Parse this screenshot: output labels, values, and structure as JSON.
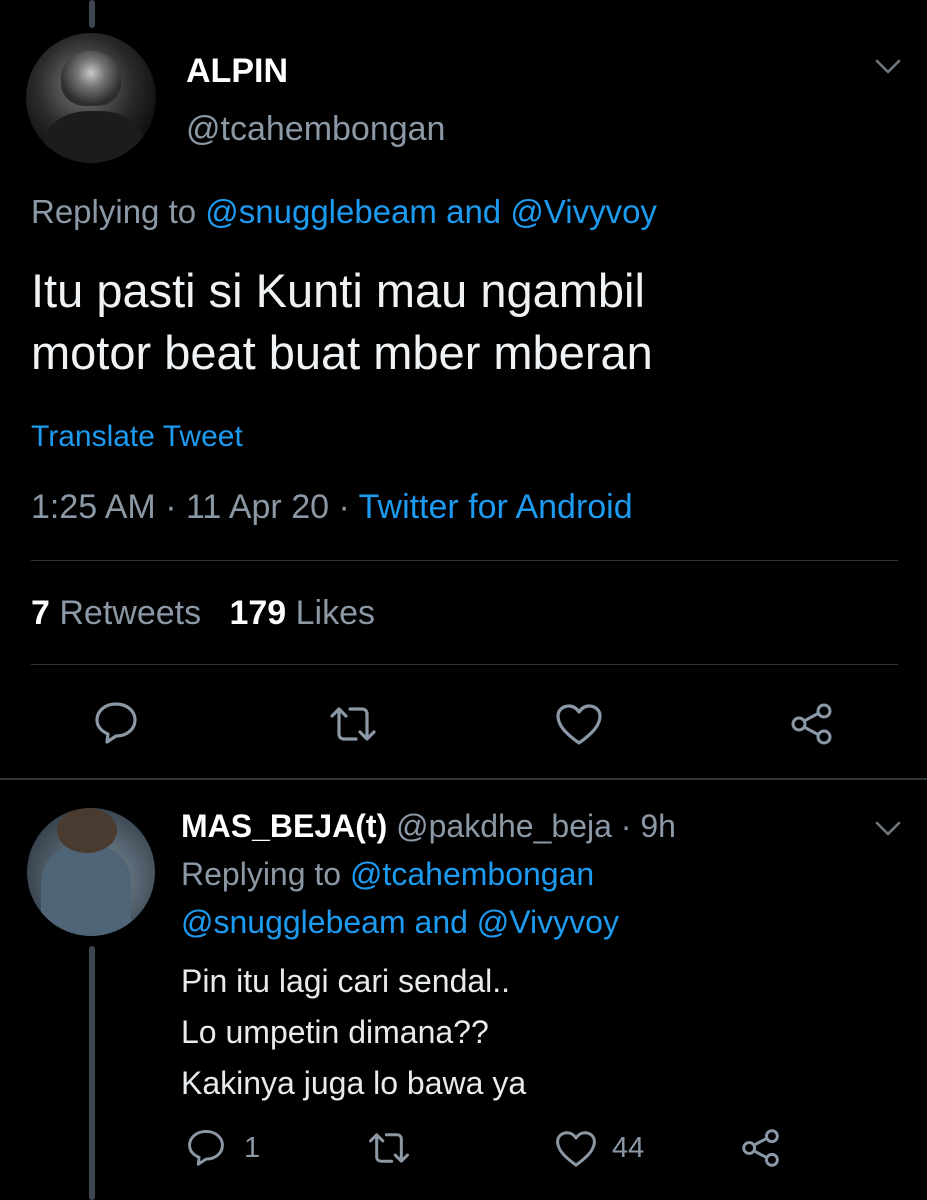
{
  "main_tweet": {
    "display_name": "ALPIN",
    "handle": "@tcahembongan",
    "replying_prefix": "Replying to ",
    "replying_user1": "@snugglebeam",
    "replying_and": " and ",
    "replying_user2": "@Vivyvoy",
    "text_line1": "Itu pasti si Kunti mau ngambil",
    "text_line2": "motor beat buat mber mberan",
    "translate_label": "Translate Tweet",
    "time": "1:25 AM",
    "sep1": " · ",
    "date": "11 Apr 20",
    "sep2": " · ",
    "source": "Twitter for Android",
    "retweets_count": "7",
    "retweets_label": "Retweets",
    "likes_count": "179",
    "likes_label": "Likes"
  },
  "reply_tweet": {
    "display_name": "MAS_BEJA(t)",
    "handle_time": "@pakdhe_beja · 9h",
    "replying_prefix": "Replying to ",
    "replying_user1": "@tcahembongan",
    "replying_line2": "@snugglebeam and @Vivyvoy",
    "text_line1": "Pin itu lagi cari sendal..",
    "text_line2": "Lo umpetin dimana??",
    "text_line3": "Kakinya juga lo bawa ya",
    "reply_count": "1",
    "like_count": "44"
  },
  "icons": [
    "chevron-down-icon",
    "reply-icon",
    "retweet-icon",
    "like-icon",
    "share-icon"
  ],
  "colors": {
    "background": "#000000",
    "link": "#1d9bf0",
    "muted": "#8b98a5",
    "divider": "#2f3336"
  }
}
